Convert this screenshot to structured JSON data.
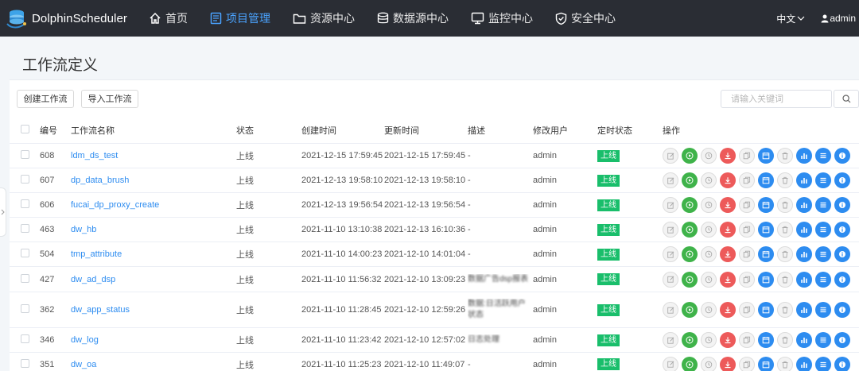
{
  "app": {
    "title": "DolphinScheduler"
  },
  "nav": {
    "items": [
      {
        "label": "首页",
        "icon": "home-icon",
        "active": false
      },
      {
        "label": "项目管理",
        "icon": "project-icon",
        "active": true
      },
      {
        "label": "资源中心",
        "icon": "folder-icon",
        "active": false
      },
      {
        "label": "数据源中心",
        "icon": "database-icon",
        "active": false
      },
      {
        "label": "监控中心",
        "icon": "monitor-icon",
        "active": false
      },
      {
        "label": "安全中心",
        "icon": "shield-icon",
        "active": false
      }
    ],
    "lang": "中文",
    "user": "admin"
  },
  "page": {
    "title": "工作流定义",
    "create_label": "创建工作流",
    "import_label": "导入工作流",
    "search_placeholder": "请输入关键词"
  },
  "table": {
    "headers": {
      "id": "编号",
      "name": "工作流名称",
      "state": "状态",
      "create_time": "创建时间",
      "update_time": "更新时间",
      "desc": "描述",
      "user": "修改用户",
      "schedule": "定时状态",
      "ops": "操作"
    },
    "rows": [
      {
        "id": "608",
        "name": "ldm_ds_test",
        "state": "上线",
        "create_time": "2021-12-15 17:59:45",
        "update_time": "2021-12-15 17:59:45",
        "desc": "-",
        "blurred": false,
        "user": "admin",
        "schedule": "上线"
      },
      {
        "id": "607",
        "name": "dp_data_brush",
        "state": "上线",
        "create_time": "2021-12-13 19:58:10",
        "update_time": "2021-12-13 19:58:10",
        "desc": "-",
        "blurred": false,
        "user": "admin",
        "schedule": "上线"
      },
      {
        "id": "606",
        "name": "fucai_dp_proxy_create",
        "state": "上线",
        "create_time": "2021-12-13 19:56:54",
        "update_time": "2021-12-13 19:56:54",
        "desc": "-",
        "blurred": false,
        "user": "admin",
        "schedule": "上线"
      },
      {
        "id": "463",
        "name": "dw_hb",
        "state": "上线",
        "create_time": "2021-11-10 13:10:38",
        "update_time": "2021-12-13 16:10:36",
        "desc": "-",
        "blurred": false,
        "user": "admin",
        "schedule": "上线"
      },
      {
        "id": "504",
        "name": "tmp_attribute",
        "state": "上线",
        "create_time": "2021-11-10 14:00:23",
        "update_time": "2021-12-10 14:01:04",
        "desc": "-",
        "blurred": false,
        "user": "admin",
        "schedule": "上线"
      },
      {
        "id": "427",
        "name": "dw_ad_dsp",
        "state": "上线",
        "create_time": "2021-11-10 11:56:32",
        "update_time": "2021-12-10 13:09:23",
        "desc": "数据广告dsp报表",
        "blurred": true,
        "user": "admin",
        "schedule": "上线"
      },
      {
        "id": "362",
        "name": "dw_app_status",
        "state": "上线",
        "create_time": "2021-11-10 11:28:45",
        "update_time": "2021-12-10 12:59:26",
        "desc": "数据:日活跃用户状态",
        "blurred": true,
        "user": "admin",
        "schedule": "上线"
      },
      {
        "id": "346",
        "name": "dw_log",
        "state": "上线",
        "create_time": "2021-11-10 11:23:42",
        "update_time": "2021-12-10 12:57:02",
        "desc": "日志处理",
        "blurred": true,
        "user": "admin",
        "schedule": "上线"
      },
      {
        "id": "351",
        "name": "dw_oa",
        "state": "上线",
        "create_time": "2021-11-10 11:25:23",
        "update_time": "2021-12-10 11:49:07",
        "desc": "-",
        "blurred": false,
        "user": "admin",
        "schedule": "上线"
      }
    ]
  },
  "row_actions": [
    {
      "name": "edit-icon",
      "style": "gray"
    },
    {
      "name": "run-icon",
      "style": "green"
    },
    {
      "name": "timing-icon",
      "style": "gray"
    },
    {
      "name": "offline-icon",
      "style": "red"
    },
    {
      "name": "copy-icon",
      "style": "gray"
    },
    {
      "name": "schedule-icon",
      "style": "blue"
    },
    {
      "name": "delete-icon",
      "style": "gray"
    },
    {
      "name": "tree-view-icon",
      "style": "blue"
    },
    {
      "name": "list-icon",
      "style": "blue"
    },
    {
      "name": "info-icon",
      "style": "blue"
    }
  ],
  "colors": {
    "nav_bg": "#2a2d34",
    "accent": "#2d8cf0",
    "online_green": "#19be6b",
    "run_green": "#3fb34a",
    "offline_red": "#ed5a5a"
  }
}
